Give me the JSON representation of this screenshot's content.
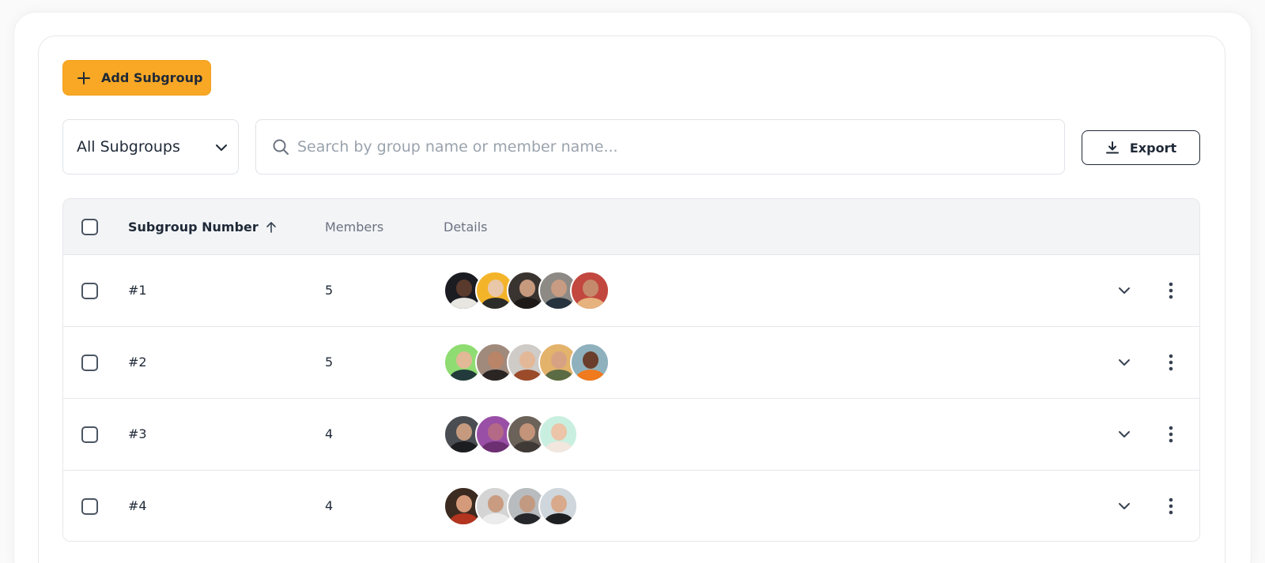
{
  "toolbar": {
    "add_label": "Add Subgroup",
    "filter_value": "All Subgroups",
    "search_placeholder": "Search by group name or member name...",
    "export_label": "Export"
  },
  "table": {
    "columns": {
      "number": "Subgroup Number",
      "members": "Members",
      "details": "Details"
    },
    "rows": [
      {
        "number": "#1",
        "members": "5"
      },
      {
        "number": "#2",
        "members": "5"
      },
      {
        "number": "#3",
        "members": "4"
      },
      {
        "number": "#4",
        "members": "4"
      }
    ]
  },
  "colors": {
    "accent": "#f9a825",
    "text": "#1f2937",
    "muted": "#6b7280",
    "header_bg": "#f3f4f6"
  },
  "icons": [
    "plus-icon",
    "chevron-down-icon",
    "search-icon",
    "download-icon",
    "sort-arrow-up-icon",
    "expand-chevron-icon",
    "more-vertical-icon"
  ]
}
